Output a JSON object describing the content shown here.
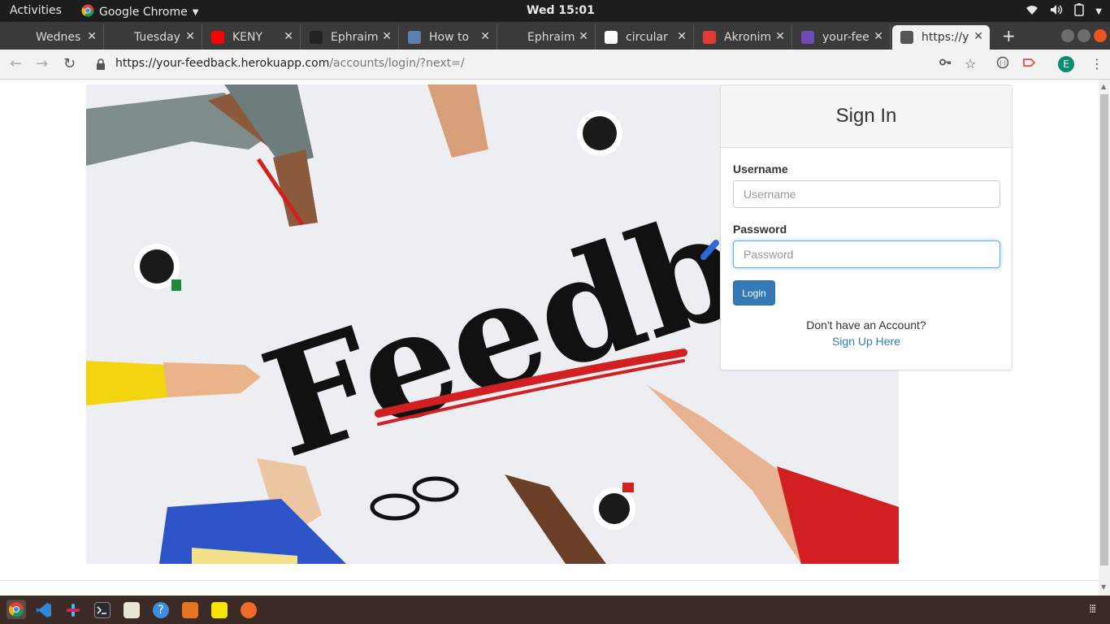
{
  "system": {
    "activities": "Activities",
    "app_name": "Google Chrome",
    "clock": "Wed 15:01"
  },
  "tabs": [
    {
      "title": "Wednes",
      "icon": "github-dark-icon",
      "color": "#3a3a3a"
    },
    {
      "title": "Tuesday",
      "icon": "github-dark-icon",
      "color": "#3a3a3a"
    },
    {
      "title": "KENY",
      "icon": "youtube-icon",
      "color": "#ff0000"
    },
    {
      "title": "Ephraim",
      "icon": "github-icon",
      "color": "#222222"
    },
    {
      "title": "How to",
      "icon": "calendar-25-icon",
      "color": "#5b7fb5"
    },
    {
      "title": "Ephraim",
      "icon": "github-dark-icon",
      "color": "#3a3a3a"
    },
    {
      "title": "circular",
      "icon": "google-icon",
      "color": "#ffffff"
    },
    {
      "title": "Akronim",
      "icon": "fonts-f-icon",
      "color": "#e53935"
    },
    {
      "title": "your-fee",
      "icon": "heroku-icon",
      "color": "#6f4bb5"
    },
    {
      "title": "https://y",
      "icon": "globe-icon",
      "color": "#555555"
    }
  ],
  "address_bar": {
    "host": "https://your-feedback.herokuapp.com",
    "path": "/accounts/login/?next=/"
  },
  "profile_initial": "E",
  "login": {
    "title": "Sign In",
    "username_label": "Username",
    "username_placeholder": "Username",
    "password_label": "Password",
    "password_placeholder": "Password",
    "login_button": "Login",
    "no_account_text": "Don't have an Account?",
    "signup_link": "Sign Up Here"
  },
  "hero": {
    "word": "Feedback"
  },
  "colors": {
    "primary_button": "#337ab7",
    "link": "#337ab7",
    "focus_border": "#66afe9",
    "topbar": "#1d1d1d",
    "dock": "#3c2a27"
  }
}
